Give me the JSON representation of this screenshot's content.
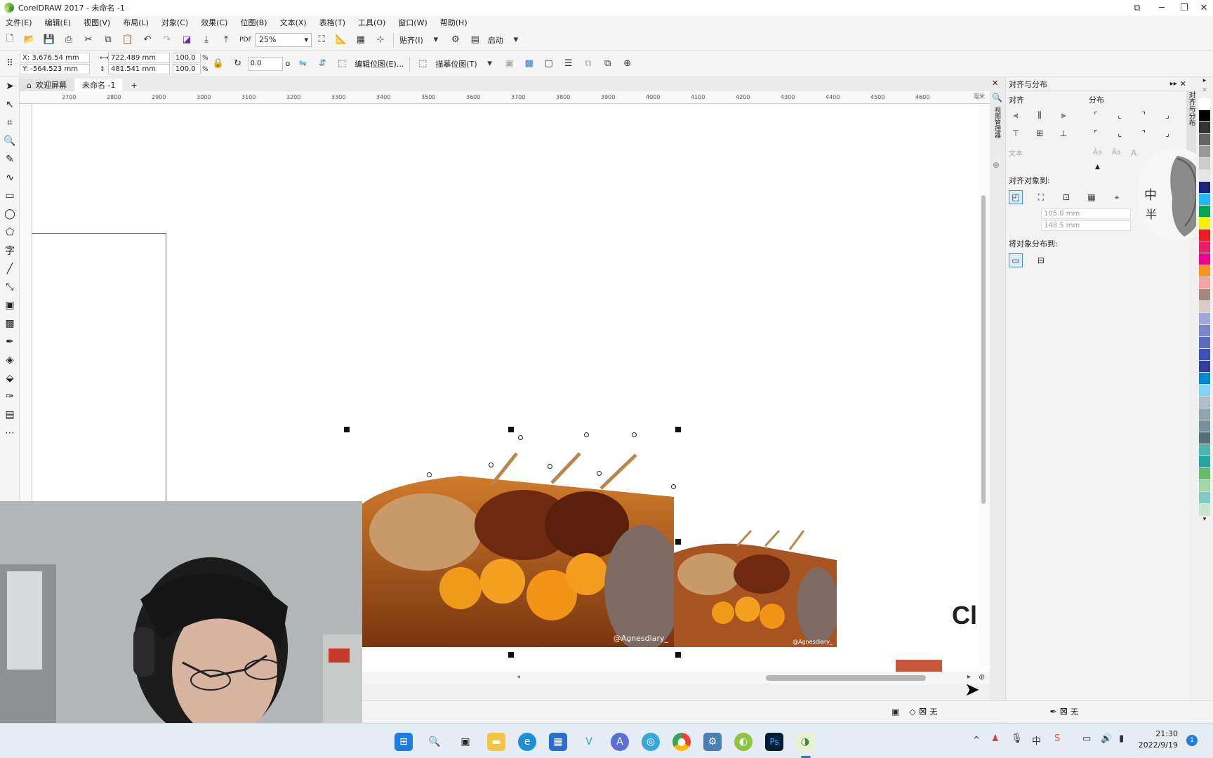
{
  "titlebar": {
    "title": "CorelDRAW 2017 - 未命名 -1"
  },
  "menu": [
    "文件(E)",
    "编辑(E)",
    "视图(V)",
    "布局(L)",
    "对象(C)",
    "效果(C)",
    "位图(B)",
    "文本(X)",
    "表格(T)",
    "工具(O)",
    "窗口(W)",
    "帮助(H)"
  ],
  "toolbar": {
    "zoom": "25%",
    "snap_label": "贴齐(I)",
    "launch_label": "启动"
  },
  "propbar": {
    "x": "X: 3,676.54 mm",
    "y": "Y: -564.523 mm",
    "width": "722.489 mm",
    "height": "481.541 mm",
    "scale_x": "100.0",
    "scale_y": "100.0",
    "percent": "%",
    "rotation": "0.0",
    "degree": "o",
    "edit_bitmap": "编辑位图(E)...",
    "trace_bitmap": "描摹位图(T)"
  },
  "tabs": {
    "welcome": "欢迎屏幕",
    "doc": "未命名 -1",
    "add": "+"
  },
  "ruler": {
    "ticks": [
      "2700",
      "2800",
      "2900",
      "3000",
      "3100",
      "3200",
      "3300",
      "3400",
      "3500",
      "3600",
      "3700",
      "3800",
      "3900",
      "4000",
      "4100",
      "4200",
      "4300",
      "4400",
      "4500",
      "4600"
    ],
    "unit": "毫米"
  },
  "canvas": {
    "watermark": "@Agnesdiary_",
    "watermark_small": "@Agnesdiary_",
    "partial_text": "Cl"
  },
  "docker": {
    "title": "对齐与分布",
    "align_label": "对齐",
    "distribute_label": "分布",
    "text_label": "文本",
    "align_to_label": "对齐对象到:",
    "coord_x": "105.0 mm",
    "coord_y": "148.5 mm",
    "distribute_to_label": "将对象分布到:",
    "side_tab_1": "对齐与分布",
    "side_tab_2": "视图管理器"
  },
  "avatar": {
    "glyph_1": "中",
    "glyph_2": "半"
  },
  "statusbar": {
    "fill_none": "无",
    "outline_none": "无"
  },
  "clock": {
    "time": "21:30",
    "date": "2022/9/19"
  },
  "palette": [
    "#ffffff",
    "#000000",
    "#333333",
    "#666666",
    "#999999",
    "#cccccc",
    "#e6e6e6",
    "#1a237e",
    "#29b6f6",
    "#00a651",
    "#fff200",
    "#ed1c24",
    "#e91e63",
    "#ec008c",
    "#f7941d",
    "#f4a6a6",
    "#a1887f",
    "#d7ccc8",
    "#9fa8da",
    "#7986cb",
    "#5c6bc0",
    "#3f51b5",
    "#303f9f",
    "#0288d1",
    "#81d4fa",
    "#b0bec5",
    "#90a4ae",
    "#78909c",
    "#546e7a",
    "#4db6ac",
    "#26a69a",
    "#66bb6a",
    "#a5d6a7",
    "#80cbc4",
    "#c8e6c9"
  ]
}
